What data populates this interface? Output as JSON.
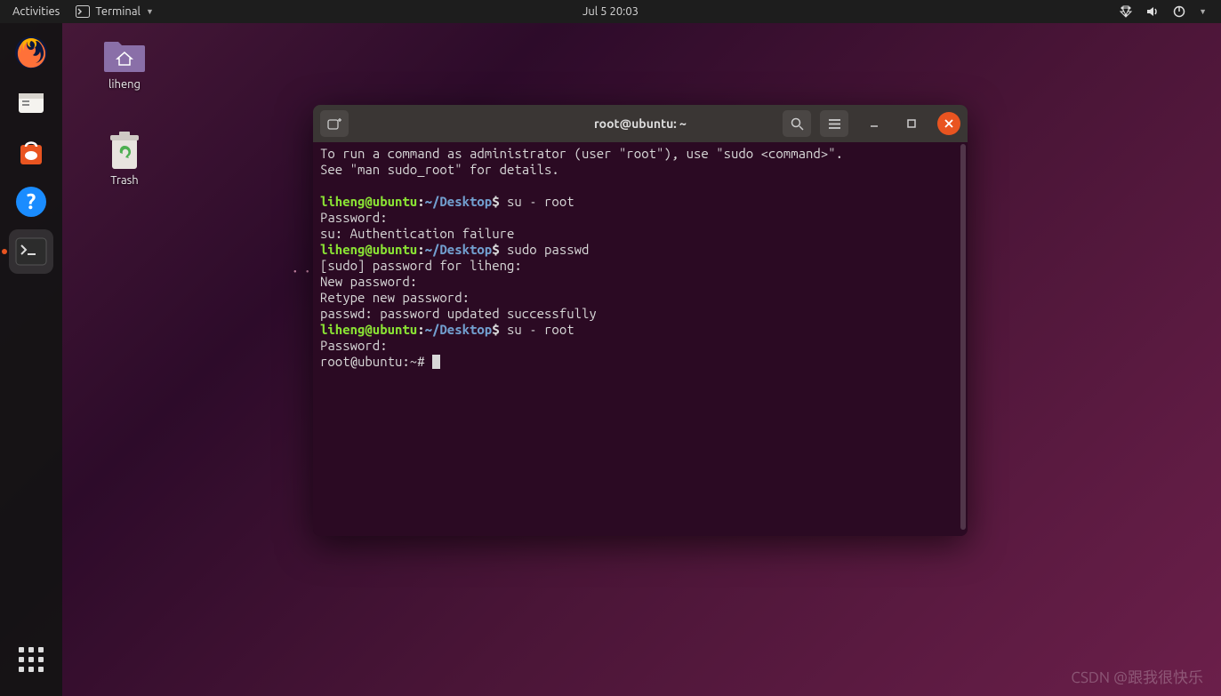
{
  "topbar": {
    "activities": "Activities",
    "app_name": "Terminal",
    "datetime": "Jul 5  20:03"
  },
  "desktop": {
    "home_label": "liheng",
    "trash_label": "Trash"
  },
  "terminal": {
    "title": "root@ubuntu: ~",
    "lines": {
      "l1": "To run a command as administrator (user \"root\"), use \"sudo <command>\".",
      "l2": "See \"man sudo_root\" for details.",
      "prompt_user": "liheng@ubuntu",
      "prompt_sep": ":",
      "prompt_path": "~/Desktop",
      "prompt_end": "$",
      "cmd1": "su - root",
      "pw": "Password: ",
      "auth_fail": "su: Authentication failure",
      "cmd2": "sudo passwd",
      "sudo_pw": "[sudo] password for liheng: ",
      "new_pw": "New password: ",
      "retype_pw": "Retype new password: ",
      "pw_ok": "passwd: password updated successfully",
      "cmd3": "su - root",
      "pw2": "Password: ",
      "root_prompt": "root@ubuntu:~# "
    }
  },
  "watermark": "CSDN @跟我很快乐"
}
